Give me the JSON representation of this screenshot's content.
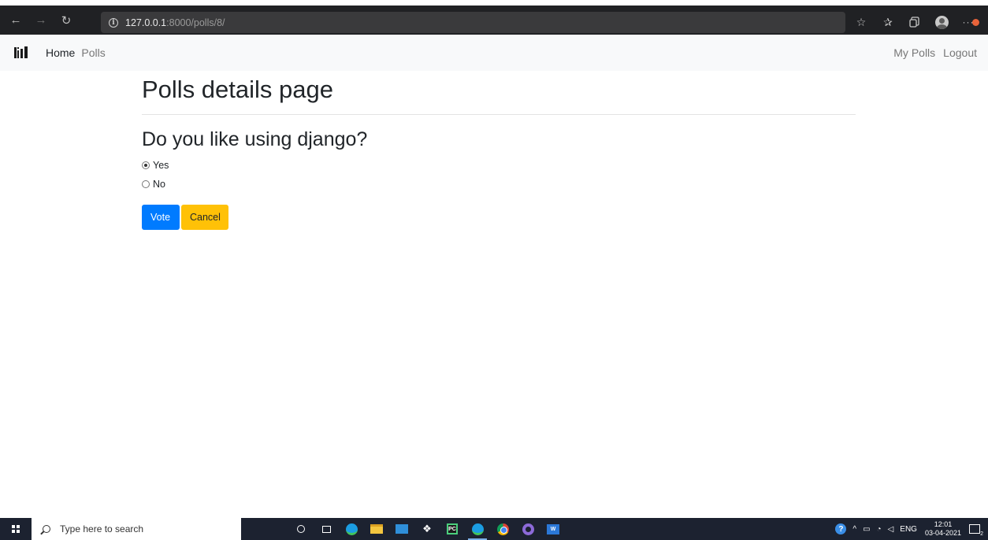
{
  "browser": {
    "url_host": "127.0.0.1",
    "url_rest": ":8000/polls/8/",
    "back_glyph": "←",
    "forward_glyph": "→",
    "reload_glyph": "↻",
    "favorite_glyph": "☆",
    "favorites_glyph": "✰"
  },
  "navbar": {
    "links": [
      {
        "label": "Home",
        "active": true
      },
      {
        "label": "Polls",
        "active": false
      }
    ],
    "right_links": [
      {
        "label": "My Polls"
      },
      {
        "label": "Logout"
      }
    ]
  },
  "page": {
    "title": "Polls details page",
    "question": "Do you like using django?",
    "choices": [
      {
        "label": "Yes",
        "checked": true
      },
      {
        "label": "No",
        "checked": false
      }
    ],
    "vote_label": "Vote",
    "cancel_label": "Cancel"
  },
  "taskbar": {
    "search_placeholder": "Type here to search",
    "language": "ENG",
    "time": "12:01",
    "date": "03-04-2021",
    "notification_count": "2",
    "dropbox_glyph": "❖",
    "pycharm_text": "PC",
    "word_text": "W",
    "help_glyph": "?",
    "chevron_glyph": "^",
    "battery_glyph": "▭",
    "wifi_glyph": "◔",
    "volume_glyph": "◁"
  },
  "colors": {
    "primary": "#007bff",
    "warning": "#ffc107",
    "navbar_bg": "#f8f9fa",
    "browser_bg": "#202124",
    "taskbar_bg": "#1c2230"
  }
}
